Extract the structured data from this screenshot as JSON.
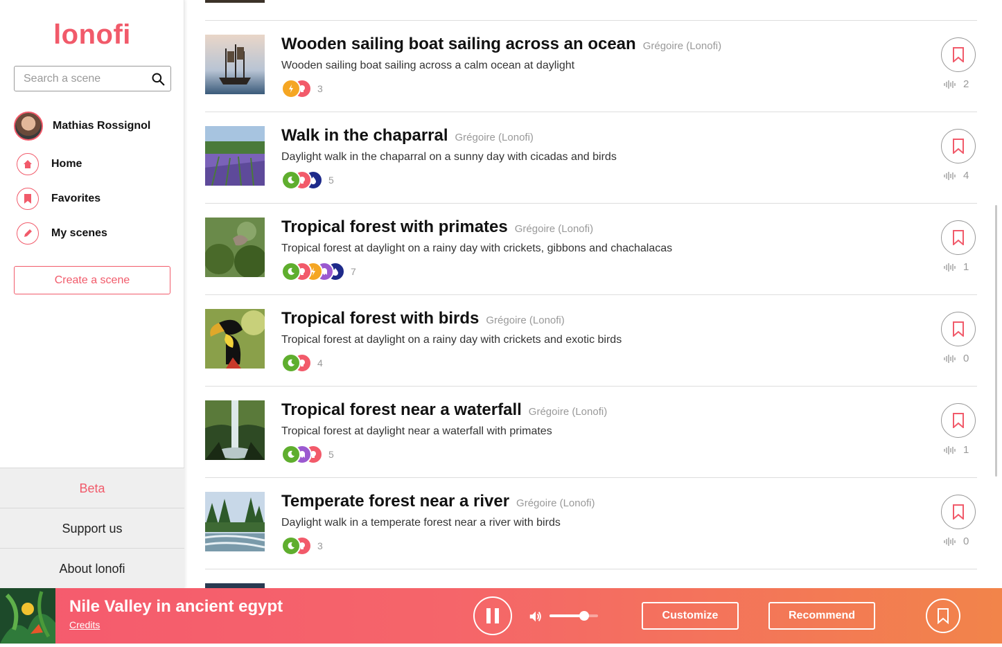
{
  "app": {
    "logo": "lonofi"
  },
  "search": {
    "placeholder": "Search a scene"
  },
  "user": {
    "name": "Mathias Rossignol"
  },
  "nav": [
    {
      "label": "Home",
      "icon": "home-icon"
    },
    {
      "label": "Favorites",
      "icon": "bookmark-icon"
    },
    {
      "label": "My scenes",
      "icon": "pencil-icon"
    }
  ],
  "create_label": "Create a scene",
  "footer": {
    "beta": "Beta",
    "support": "Support us",
    "about": "About lonofi"
  },
  "colors": {
    "accent": "#f15a6a",
    "green": "#5fae2e",
    "orange": "#f5a623",
    "pink": "#f25a6a",
    "purple": "#9b59d0",
    "navy": "#1e2a8a"
  },
  "scenes": [
    {
      "title": "Wooden sailing boat sailing across an ocean",
      "author": "Grégoire (Lonofi)",
      "description": "Wooden sailing boat sailing across a calm ocean at daylight",
      "tags": [
        "weather-icon",
        "sound-icon"
      ],
      "tag_count": "3",
      "plays": "2"
    },
    {
      "title": "Walk in the chaparral",
      "author": "Grégoire (Lonofi)",
      "description": "Daylight walk in the chaparral on a sunny day with cicadas and birds",
      "tags": [
        "time-icon",
        "sound-icon",
        "water-icon"
      ],
      "tag_count": "5",
      "plays": "4"
    },
    {
      "title": "Tropical forest with primates",
      "author": "Grégoire (Lonofi)",
      "description": "Tropical forest at daylight on a rainy day with crickets, gibbons and chachalacas",
      "tags": [
        "time-icon",
        "sound-icon",
        "weather-icon",
        "ghost-icon",
        "water-icon"
      ],
      "tag_count": "7",
      "plays": "1"
    },
    {
      "title": "Tropical forest with birds",
      "author": "Grégoire (Lonofi)",
      "description": "Tropical forest at daylight on a rainy day with crickets and exotic birds",
      "tags": [
        "time-icon",
        "sound-icon"
      ],
      "tag_count": "4",
      "plays": "0"
    },
    {
      "title": "Tropical forest near a waterfall",
      "author": "Grégoire (Lonofi)",
      "description": "Tropical forest at daylight near a waterfall with primates",
      "tags": [
        "time-icon",
        "ghost-icon",
        "sound-icon"
      ],
      "tag_count": "5",
      "plays": "1"
    },
    {
      "title": "Temperate forest near a river",
      "author": "Grégoire (Lonofi)",
      "description": "Daylight walk in a temperate forest near a river with birds",
      "tags": [
        "time-icon",
        "sound-icon"
      ],
      "tag_count": "3",
      "plays": "0"
    }
  ],
  "player": {
    "title": "Nile Valley in ancient egypt",
    "credits": "Credits",
    "volume": 0.72,
    "customize": "Customize",
    "recommend": "Recommend"
  }
}
